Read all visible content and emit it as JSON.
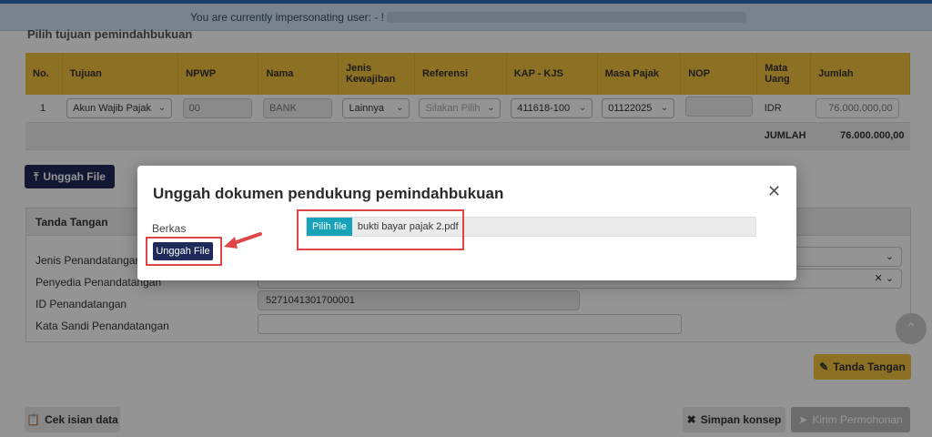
{
  "banner": {
    "text": "You are currently impersonating user: - ! BANK"
  },
  "section": {
    "title": "Pilih tujuan pemindahbukuan"
  },
  "table": {
    "headers": [
      "No.",
      "Tujuan",
      "NPWP",
      "Nama",
      "Jenis Kewajiban",
      "Referensi",
      "KAP - KJS",
      "Masa Pajak",
      "NOP",
      "Mata Uang",
      "Jumlah"
    ],
    "row": {
      "no": "1",
      "tujuan": "Akun Wajib Pajak",
      "npwp": "00",
      "nama": "BANK",
      "jenis_kewajiban": "Lainnya",
      "referensi_placeholder": "Silakan Pilih",
      "kap_kjs": "411618-100",
      "masa_pajak": "01122025",
      "nop": "",
      "mata_uang": "IDR",
      "jumlah": "76.000.000,00"
    },
    "sum_label": "JUMLAH",
    "sum_value": "76.000.000,00"
  },
  "upload_button": {
    "label": "Unggah File",
    "icon": "upload-icon"
  },
  "signature_card": {
    "title": "Tanda Tangan",
    "fields": {
      "jenis_label": "Jenis Penandatanganan*",
      "penyedia_label": "Penyedia Penandatangan",
      "id_label": "ID Penandatangan",
      "id_value": "5271041301700001",
      "sandi_label": "Kata Sandi Penandatangan"
    }
  },
  "actions": {
    "tanda_tangan": "Tanda Tangan",
    "cek_isian": "Cek isian data",
    "simpan": "Simpan konsep",
    "kirim": "Kirim Permohonan"
  },
  "modal": {
    "title": "Unggah dokumen pendukung pemindahbukuan",
    "close_icon": "close-icon",
    "berkas_label": "Berkas",
    "upload_label": "Unggah File",
    "pilih_label": "Pilih file",
    "file_name": "bukti bayar pajak 2.pdf"
  },
  "colors": {
    "navy": "#1f2a5a",
    "table_header": "#f2c23d",
    "highlight": "#e04545",
    "file_button": "#17a2b8"
  }
}
